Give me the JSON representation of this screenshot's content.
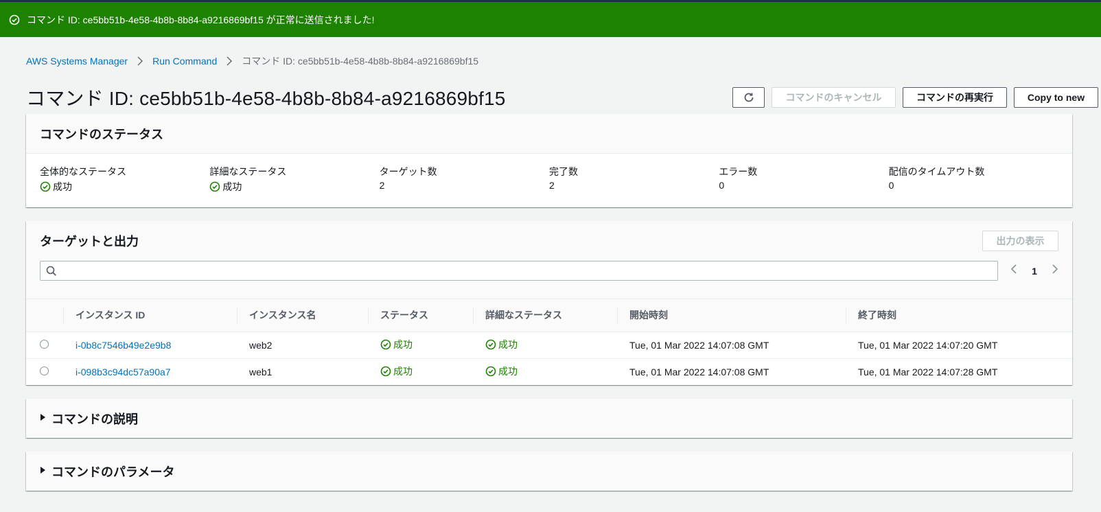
{
  "flash": {
    "message": "コマンド ID: ce5bb51b-4e58-4b8b-8b84-a9216869bf15 が正常に送信されました!"
  },
  "breadcrumb": {
    "items": [
      "AWS Systems Manager",
      "Run Command"
    ],
    "current": "コマンド ID: ce5bb51b-4e58-4b8b-8b84-a9216869bf15"
  },
  "header": {
    "title": "コマンド ID: ce5bb51b-4e58-4b8b-8b84-a9216869bf15",
    "cancel_label": "コマンドのキャンセル",
    "rerun_label": "コマンドの再実行",
    "copy_label": "Copy to new"
  },
  "status": {
    "title": "コマンドのステータス",
    "fields": [
      {
        "label": "全体的なステータス",
        "value": "成功",
        "success": true
      },
      {
        "label": "詳細なステータス",
        "value": "成功",
        "success": true
      },
      {
        "label": "ターゲット数",
        "value": "2"
      },
      {
        "label": "完了数",
        "value": "2"
      },
      {
        "label": "エラー数",
        "value": "0"
      },
      {
        "label": "配信のタイムアウト数",
        "value": "0"
      }
    ]
  },
  "targets": {
    "title": "ターゲットと出力",
    "show_output_label": "出力の表示",
    "search_placeholder": "",
    "page": "1",
    "columns": [
      "インスタンス ID",
      "インスタンス名",
      "ステータス",
      "詳細なステータス",
      "開始時刻",
      "終了時刻"
    ],
    "rows": [
      {
        "id": "i-0b8c7546b49e2e9b8",
        "name": "web2",
        "status": "成功",
        "detail": "成功",
        "start": "Tue, 01 Mar 2022 14:07:08 GMT",
        "end": "Tue, 01 Mar 2022 14:07:20 GMT"
      },
      {
        "id": "i-098b3c94dc57a90a7",
        "name": "web1",
        "status": "成功",
        "detail": "成功",
        "start": "Tue, 01 Mar 2022 14:07:08 GMT",
        "end": "Tue, 01 Mar 2022 14:07:28 GMT"
      }
    ]
  },
  "description": {
    "title": "コマンドの説明"
  },
  "parameters": {
    "title": "コマンドのパラメータ"
  },
  "colors": {
    "success": "#1d8102",
    "link": "#0073bb",
    "flash_bg": "#1d8102"
  }
}
